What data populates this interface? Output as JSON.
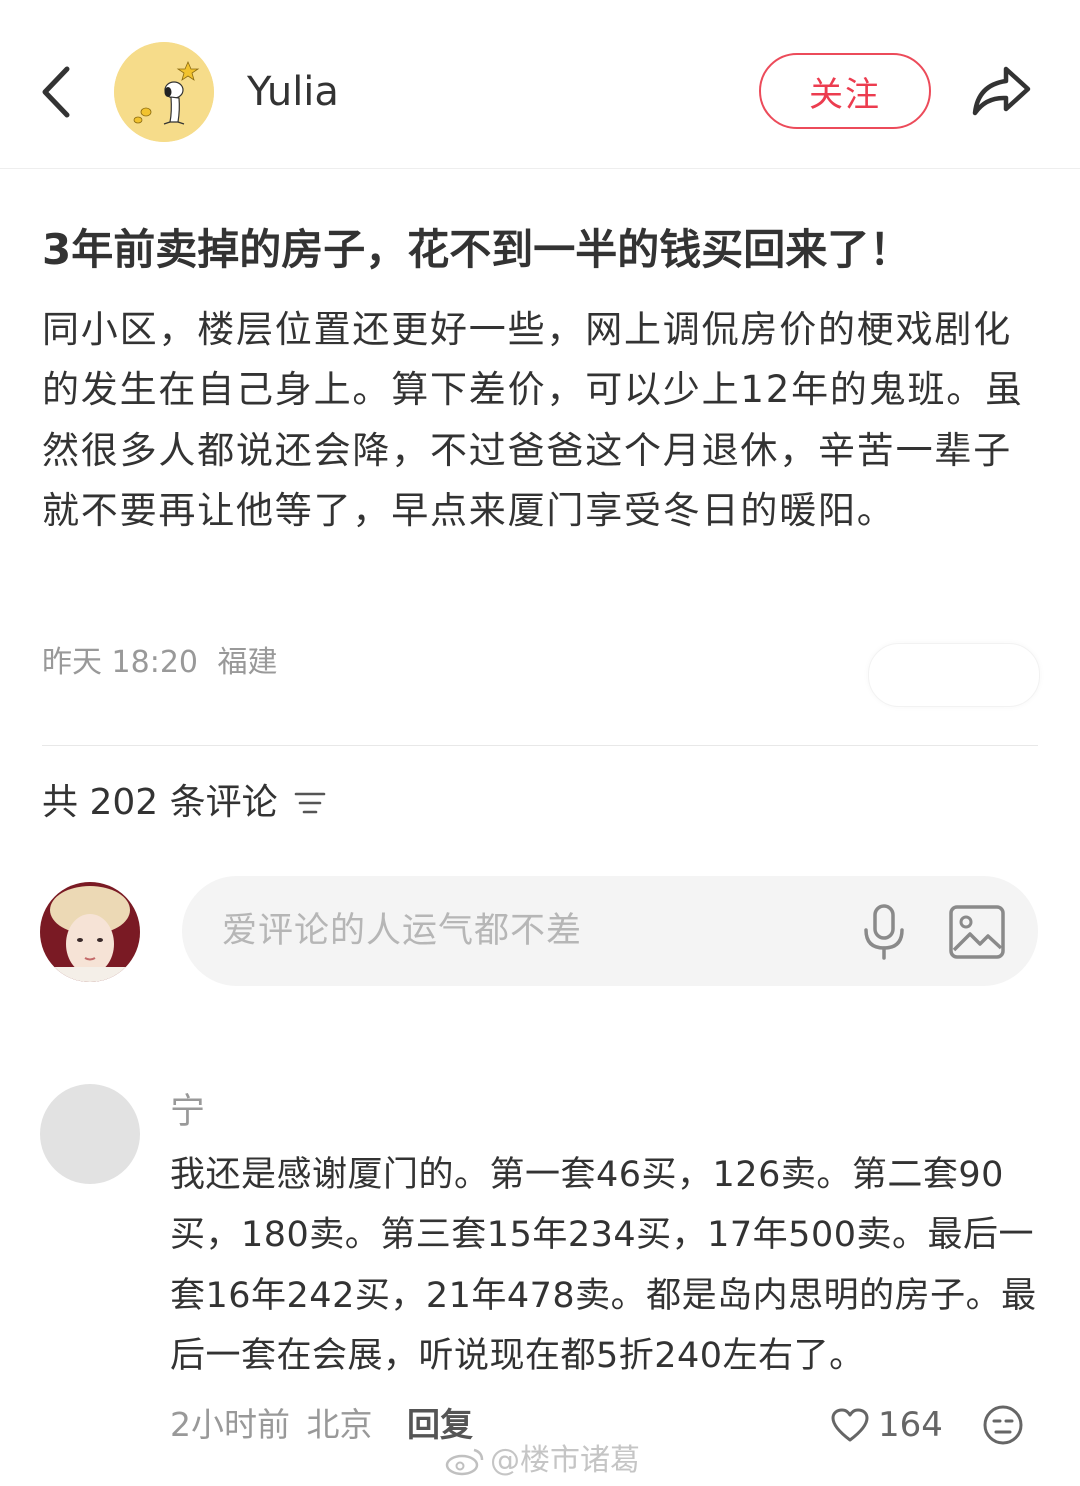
{
  "header": {
    "author_name": "Yulia",
    "follow_label": "关注",
    "icons": {
      "back": "chevron-left-icon",
      "share": "share-arrow-icon"
    }
  },
  "post": {
    "title": "3年前卖掉的房子，花不到一半的钱买回来了！",
    "body": "同小区，楼层位置还更好一些，网上调侃房价的梗戏剧化的发生在自己身上。算下差价，可以少上12年的鬼班。虽然很多人都说还会降，不过爸爸这个月退休，辛苦一辈子就不要再让他等了，早点来厦门享受冬日的暖阳。",
    "time": "昨天 18:20",
    "location": "福建"
  },
  "comments_header": {
    "count_label": "共 202 条评论",
    "sort_icon": "sort-lines-icon"
  },
  "comment_input": {
    "placeholder": "爱评论的人运气都不差",
    "icons": {
      "mic": "microphone-icon",
      "image": "image-icon"
    }
  },
  "comments": [
    {
      "name": "宁",
      "text": "我还是感谢厦门的。第一套46买，126卖。第二套90买，180卖。第三套15年234买，17年500卖。最后一套16年242买，21年478卖。都是岛内思明的房子。最后一套在会展，听说现在都5折240左右了。",
      "time": "2小时前",
      "location": "北京",
      "reply_label": "回复",
      "likes": "164"
    }
  ],
  "watermark": "@楼市诸葛",
  "colors": {
    "accent": "#ec3c4f",
    "text": "#333333",
    "muted": "#999999",
    "input_bg": "#f4f4f4",
    "avatar_bg": "#f6dc8a"
  }
}
